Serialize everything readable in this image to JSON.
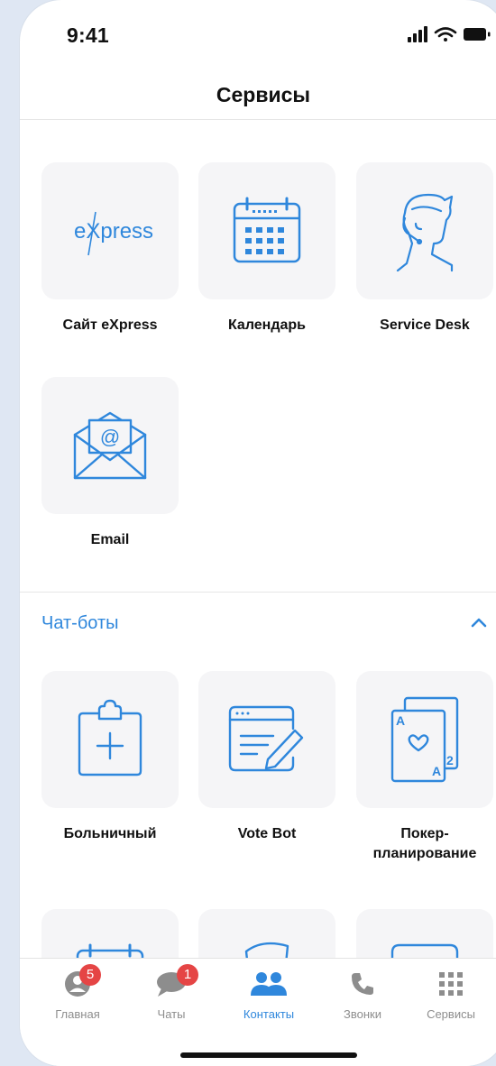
{
  "status": {
    "time": "9:41"
  },
  "header": {
    "title": "Сервисы"
  },
  "services": [
    {
      "label": "Сайт eXpress",
      "icon": "express-logo-icon"
    },
    {
      "label": "Календарь",
      "icon": "calendar-icon"
    },
    {
      "label": "Service Desk",
      "icon": "support-agent-icon"
    },
    {
      "label": "Email",
      "icon": "email-icon"
    }
  ],
  "chatbots": {
    "title": "Чат-боты",
    "items": [
      {
        "label": "Больничный",
        "icon": "sick-leave-icon"
      },
      {
        "label": "Vote Bot",
        "icon": "vote-bot-icon"
      },
      {
        "label_line1": "Покер-",
        "label_line2": "планирование",
        "icon": "poker-cards-icon"
      }
    ]
  },
  "tabbar": {
    "items": [
      {
        "label": "Главная",
        "badge": "5",
        "icon": "profile-icon"
      },
      {
        "label": "Чаты",
        "badge": "1",
        "icon": "chat-bubble-icon"
      },
      {
        "label": "Контакты",
        "icon": "contacts-icon",
        "active": true
      },
      {
        "label": "Звонки",
        "icon": "phone-icon"
      },
      {
        "label": "Сервисы",
        "icon": "grid-icon"
      }
    ]
  },
  "colors": {
    "accent": "#2f87dc",
    "tile_bg": "#f5f5f7",
    "badge": "#e54545"
  },
  "express_logo_text": "eXpress"
}
